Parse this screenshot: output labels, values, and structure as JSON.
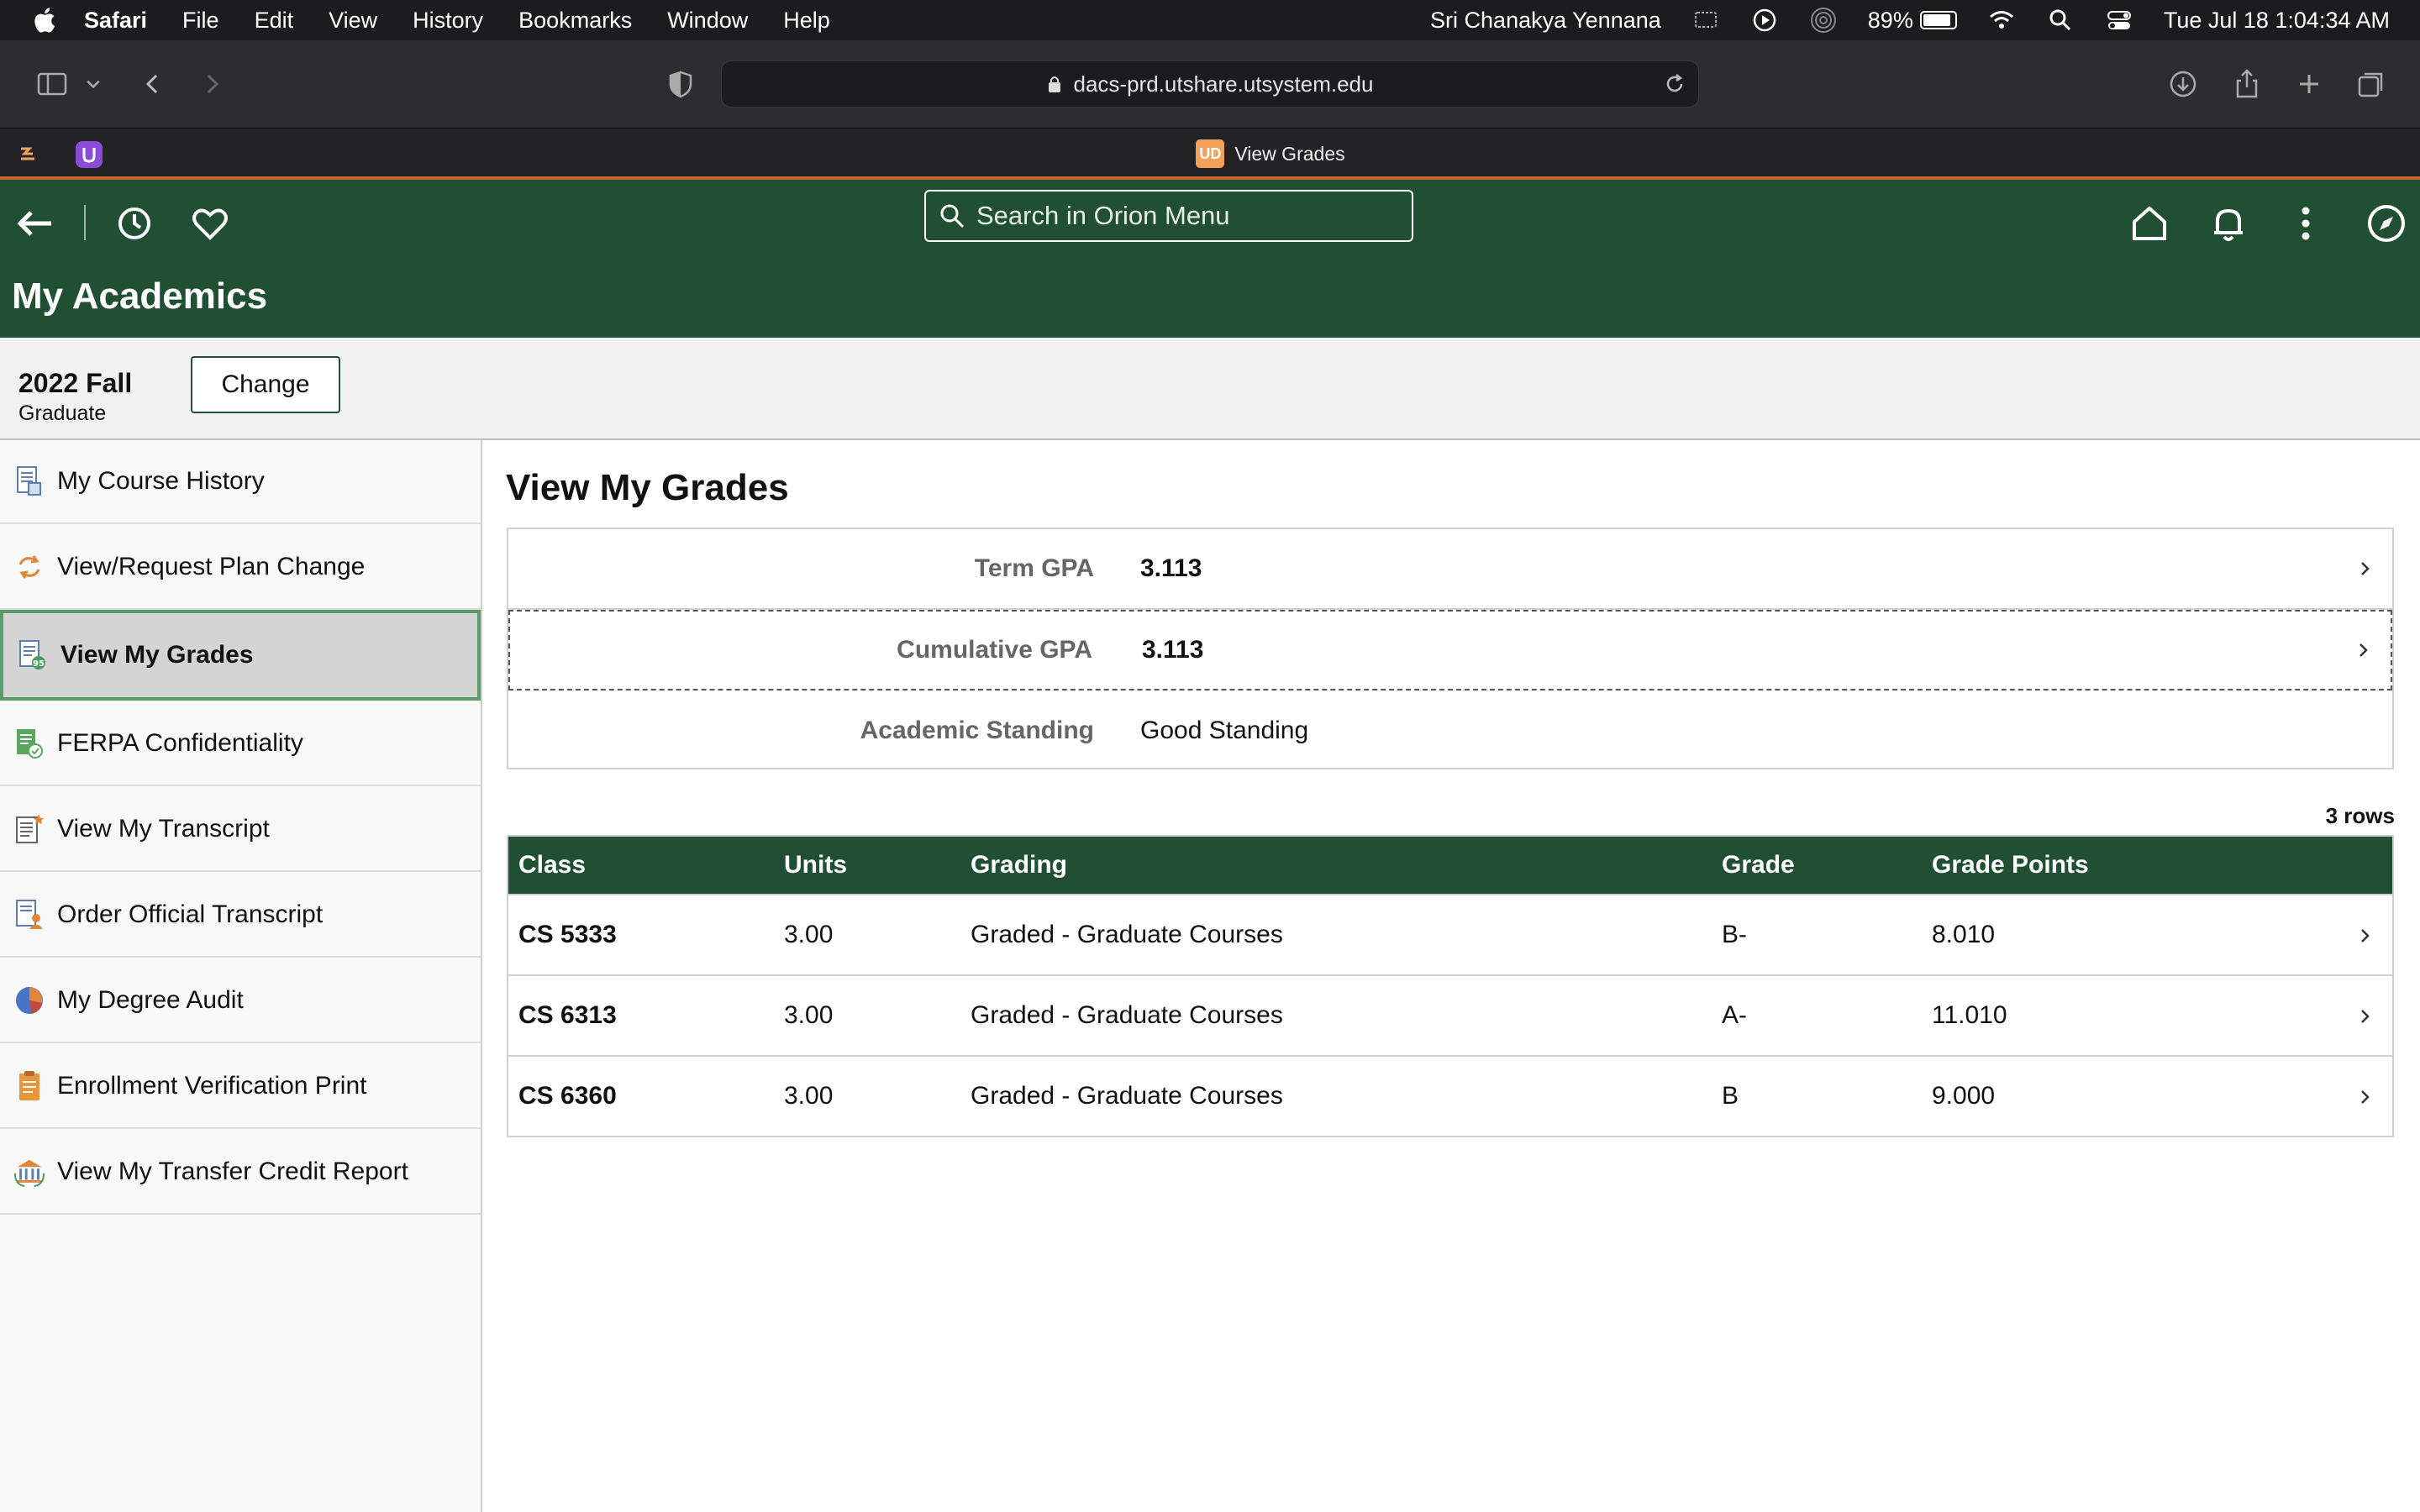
{
  "menubar": {
    "app": "Safari",
    "menus": [
      "File",
      "Edit",
      "View",
      "History",
      "Bookmarks",
      "Window",
      "Help"
    ],
    "user": "Sri Chanakya Yennana",
    "battery": "89%",
    "battery_level": 0.89,
    "datetime": "Tue Jul 18  1:04:34 AM"
  },
  "browser": {
    "url": "dacs-prd.utshare.utsystem.edu",
    "tab_title": "View Grades",
    "tab_favicon": "UD"
  },
  "header": {
    "search_placeholder": "Search in Orion Menu",
    "page_title": "My Academics"
  },
  "term": {
    "name": "2022 Fall",
    "career": "Graduate",
    "change_label": "Change"
  },
  "sidebar": {
    "items": [
      {
        "label": "My Course History",
        "icon": "course-history-icon"
      },
      {
        "label": "View/Request Plan Change",
        "icon": "plan-change-icon"
      },
      {
        "label": "View My Grades",
        "icon": "grades-icon"
      },
      {
        "label": "FERPA Confidentiality",
        "icon": "ferpa-icon"
      },
      {
        "label": "View My Transcript",
        "icon": "transcript-icon"
      },
      {
        "label": "Order Official Transcript",
        "icon": "order-transcript-icon"
      },
      {
        "label": "My Degree Audit",
        "icon": "degree-audit-icon"
      },
      {
        "label": "Enrollment Verification Print",
        "icon": "enrollment-verification-icon"
      },
      {
        "label": "View My Transfer Credit Report",
        "icon": "transfer-credit-icon"
      }
    ]
  },
  "main": {
    "title": "View My Grades",
    "gpa": [
      {
        "label": "Term GPA",
        "value": "3.113"
      },
      {
        "label": "Cumulative GPA",
        "value": "3.113"
      },
      {
        "label": "Academic Standing",
        "value": "Good Standing"
      }
    ],
    "row_count": "3 rows",
    "columns": [
      "Class",
      "Units",
      "Grading",
      "Grade",
      "Grade Points"
    ],
    "rows": [
      {
        "class": "CS 5333",
        "units": "3.00",
        "grading": "Graded - Graduate Courses",
        "grade": "B-",
        "points": "8.010"
      },
      {
        "class": "CS 6313",
        "units": "3.00",
        "grading": "Graded - Graduate Courses",
        "grade": "A-",
        "points": "11.010"
      },
      {
        "class": "CS 6360",
        "units": "3.00",
        "grading": "Graded - Graduate Courses",
        "grade": "B",
        "points": "9.000"
      }
    ]
  },
  "colors": {
    "brand_green": "#214f34",
    "accent_orange": "#c8662a",
    "active_border": "#5b9a6a"
  }
}
